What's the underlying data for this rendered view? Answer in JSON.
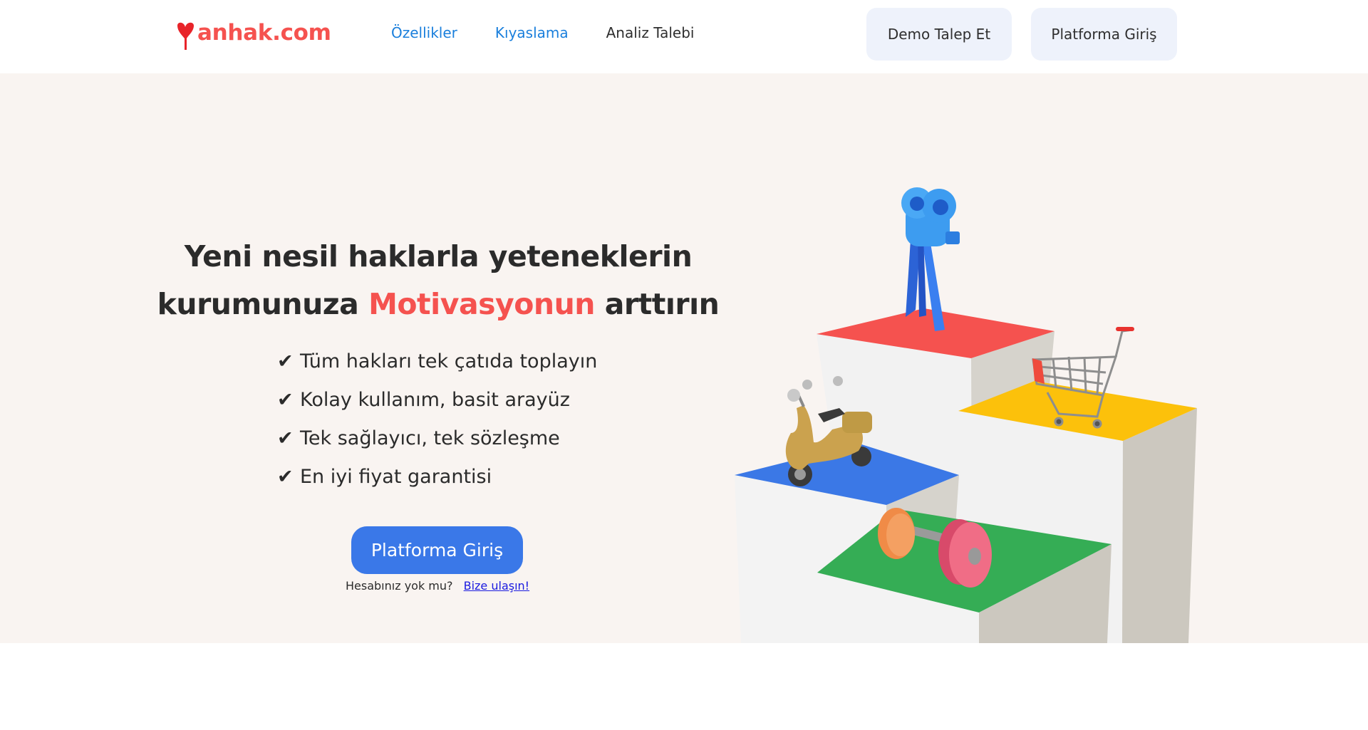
{
  "header": {
    "logo_letter": "Y",
    "logo_text": "anhak.com",
    "nav": [
      {
        "label": "Özellikler"
      },
      {
        "label": "Kıyaslama"
      },
      {
        "label": "Analiz Talebi"
      }
    ],
    "demo_button": "Demo Talep Et",
    "login_button": "Platforma Giriş"
  },
  "hero": {
    "title_line1": "Yeni nesil haklarla yeteneklerin",
    "title_line2_start": "kurumunuza",
    "title_accent": "Motivasyonun",
    "title_line2_end": "arttırın",
    "check_mark": "✔",
    "features": [
      "Tüm hakları tek çatıda toplayın",
      "Kolay kullanım, basit arayüz",
      "Tek sağlayıcı, tek sözleşme",
      "En iyi fiyat garantisi"
    ],
    "cta_button": "Platforma Giriş",
    "no_account_text": "Hesabınız yok mu?",
    "contact_link": "Bize ulaşın!"
  },
  "illustration": {
    "icons": [
      "movie-camera-icon",
      "shopping-cart-icon",
      "scooter-icon",
      "dumbbell-icon"
    ],
    "colors": {
      "red": "#f5524f",
      "yellow": "#fcc10b",
      "blue": "#3b78e6",
      "green": "#35ad55",
      "camera": "#3d9cf0"
    }
  },
  "colors": {
    "brand": "#f5524f",
    "nav_link": "#1a7fdc",
    "primary_button": "#3a78e8",
    "header_button_bg": "#eef2fb",
    "hero_bg": "#f9f4f1"
  }
}
